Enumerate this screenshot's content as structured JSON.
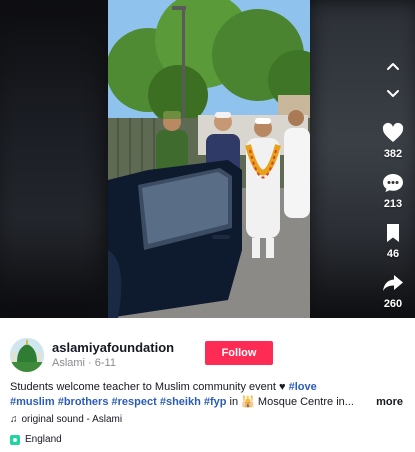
{
  "video": {
    "description_blank": ""
  },
  "rail": {
    "up_icon": "chevron-up-icon",
    "down_icon": "chevron-down-icon",
    "like_count": "382",
    "comment_count": "213",
    "bookmark_count": "46",
    "share_count": "260"
  },
  "author": {
    "name": "aslamiyafoundation",
    "sub": "Aslami · 6-11",
    "follow_label": "Follow"
  },
  "caption": {
    "text": "Students welcome teacher to Muslim community event ♥ ",
    "tags": [
      "#love",
      "#muslim",
      "#brothers",
      "#respect",
      "#sheikh",
      "#fyp"
    ],
    "location_text": " in 🕌 Mosque Centre in...",
    "more_label": "more"
  },
  "sound": {
    "label": "original sound - Aslami"
  },
  "location": {
    "label": "England"
  },
  "colors": {
    "follow": "#fe2c55",
    "tag": "#2b5db8"
  }
}
